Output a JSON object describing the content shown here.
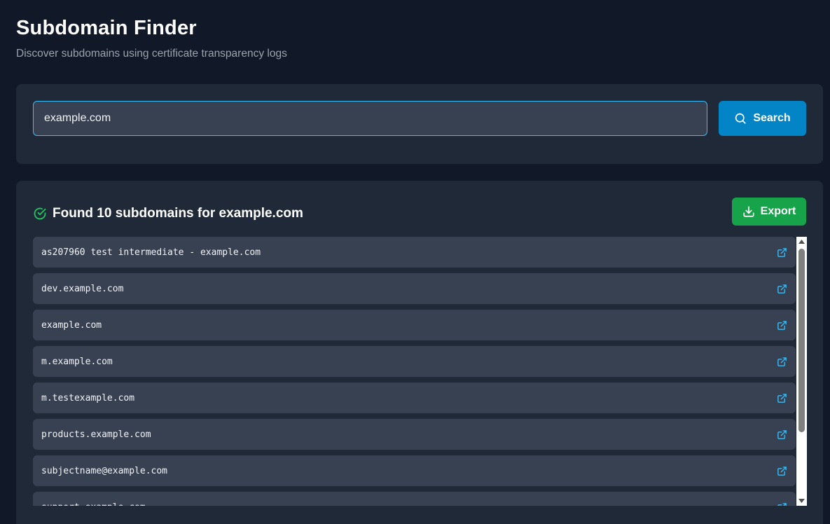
{
  "header": {
    "title": "Subdomain Finder",
    "subtitle": "Discover subdomains using certificate transparency logs"
  },
  "search": {
    "value": "example.com",
    "button_label": "Search"
  },
  "results": {
    "title": "Found 10 subdomains for example.com",
    "export_label": "Export",
    "items": [
      "as207960 test intermediate - example.com",
      "dev.example.com",
      "example.com",
      "m.example.com",
      "m.testexample.com",
      "products.example.com",
      "subjectname@example.com",
      "support.example.com"
    ]
  },
  "colors": {
    "accent_blue": "#0284c7",
    "export_green": "#16a34a",
    "success_icon": "#22c55e",
    "link_icon": "#38bdf8"
  },
  "icons": {
    "search": "search-icon",
    "success": "check-circle-icon",
    "export": "download-icon",
    "item_link": "external-link-icon"
  }
}
